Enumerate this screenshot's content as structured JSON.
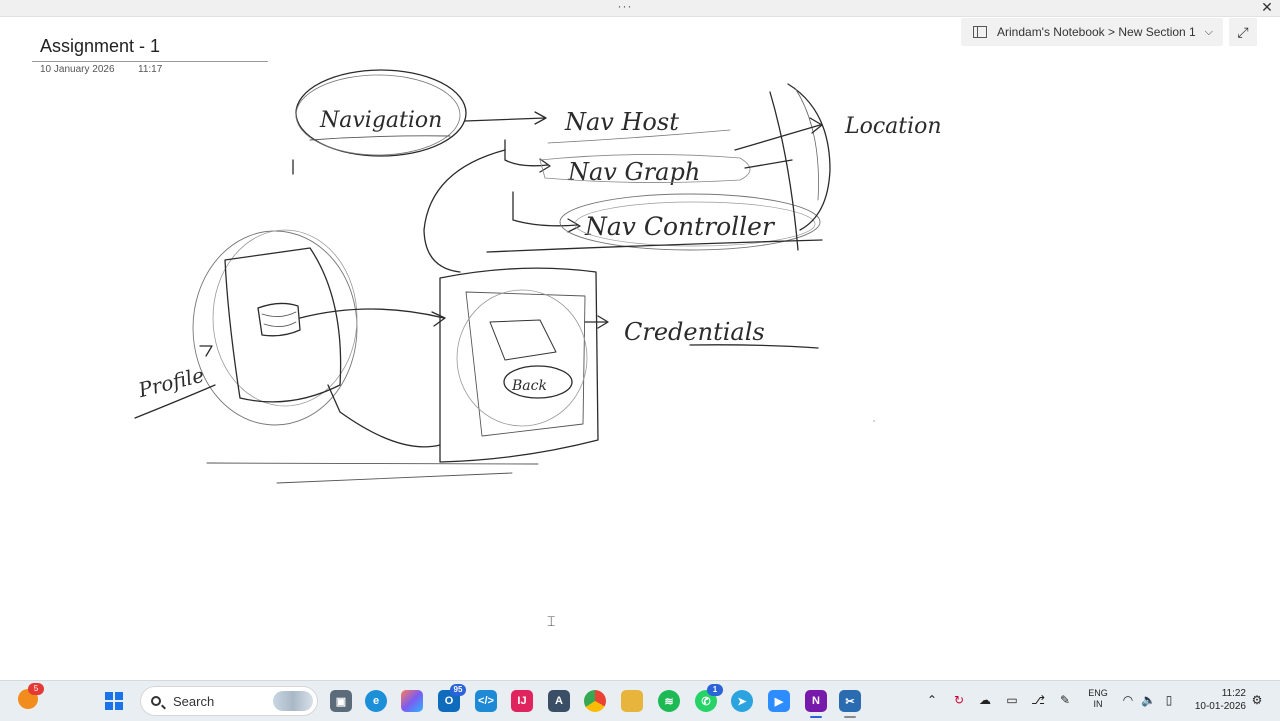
{
  "window": {
    "grip_label": "···",
    "close_label": "✕"
  },
  "breadcrumb": {
    "notebook": "Arindam's Notebook",
    "separator": ">",
    "section": "New Section 1",
    "full": "Arindam's Notebook > New Section 1"
  },
  "page": {
    "title": "Assignment - 1",
    "date": "10 January 2026",
    "time": "11:17"
  },
  "ink": {
    "labels": [
      "Navigation",
      "Nav Host",
      "Nav Graph",
      "Nav Controller",
      "Location",
      "Profile",
      "Credentials",
      "Back"
    ]
  },
  "taskbar": {
    "search_placeholder": "Search",
    "notification_count": "5",
    "apps": [
      {
        "name": "start",
        "icon": "windows-icon"
      },
      {
        "name": "task-view",
        "icon": "task-view-icon"
      },
      {
        "name": "edge",
        "icon": "edge-icon",
        "color": "#1b8fd8"
      },
      {
        "name": "copilot",
        "icon": "copilot-icon",
        "color": "#7b5cf0"
      },
      {
        "name": "outlook",
        "icon": "outlook-icon",
        "color": "#0f6cbd",
        "badge": "95"
      },
      {
        "name": "vscode",
        "icon": "vscode-icon",
        "color": "#1e8ad6"
      },
      {
        "name": "intellij",
        "icon": "intellij-icon",
        "color": "#e0245e"
      },
      {
        "name": "android-studio",
        "icon": "android-studio-icon",
        "color": "#3a4f66"
      },
      {
        "name": "chrome",
        "icon": "chrome-icon",
        "color": "#f2b400"
      },
      {
        "name": "file-explorer",
        "icon": "folder-icon",
        "color": "#e7b53b"
      },
      {
        "name": "spotify",
        "icon": "spotify-icon",
        "color": "#1db954"
      },
      {
        "name": "whatsapp",
        "icon": "whatsapp-icon",
        "color": "#25d366",
        "badge": "1"
      },
      {
        "name": "telegram",
        "icon": "telegram-icon",
        "color": "#2aa3df"
      },
      {
        "name": "zoom",
        "icon": "zoom-icon",
        "color": "#2d8cff"
      },
      {
        "name": "onenote",
        "icon": "onenote-icon",
        "color": "#7719aa"
      },
      {
        "name": "snipping-tool",
        "icon": "snipping-icon",
        "color": "#2b6cb0"
      }
    ]
  },
  "tray": {
    "language_line1": "ENG",
    "language_line2": "IN",
    "time": "11:22",
    "date": "10-01-2026"
  }
}
